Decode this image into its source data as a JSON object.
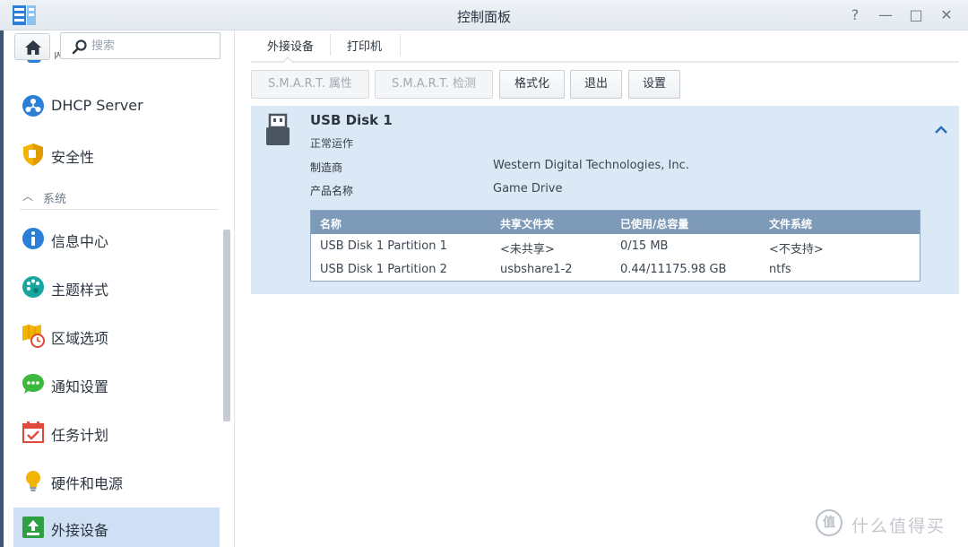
{
  "window": {
    "title": "控制面板",
    "buttons": {
      "help": "?",
      "minimize": "—",
      "maximize": "□",
      "close": "✕"
    }
  },
  "sidebar": {
    "search_placeholder": "搜索",
    "partial_item_label": "网络",
    "items": [
      {
        "label": "DHCP Server",
        "icon": "dhcp-server-icon"
      },
      {
        "label": "安全性",
        "icon": "shield-icon"
      }
    ],
    "section_label": "系统",
    "system_items": [
      {
        "label": "信息中心",
        "icon": "info-icon"
      },
      {
        "label": "主题样式",
        "icon": "palette-icon"
      },
      {
        "label": "区域选项",
        "icon": "map-clock-icon"
      },
      {
        "label": "通知设置",
        "icon": "chat-bubble-icon"
      },
      {
        "label": "任务计划",
        "icon": "calendar-check-icon"
      },
      {
        "label": "硬件和电源",
        "icon": "lightbulb-icon"
      },
      {
        "label": "外接设备",
        "icon": "external-device-icon",
        "active": true
      }
    ]
  },
  "tabs": [
    {
      "label": "外接设备",
      "active": true
    },
    {
      "label": "打印机",
      "active": false
    }
  ],
  "toolbar": {
    "smart_attributes": "S.M.A.R.T. 属性",
    "smart_test": "S.M.A.R.T. 检测",
    "format": "格式化",
    "eject": "退出",
    "settings": "设置"
  },
  "disk": {
    "name": "USB Disk 1",
    "status": "正常运作",
    "manufacturer_label": "制造商",
    "manufacturer": "Western Digital Technologies, Inc.",
    "product_label": "产品名称",
    "product": "Game Drive",
    "table": {
      "headers": [
        "名称",
        "共享文件夹",
        "已使用/总容量",
        "文件系统"
      ],
      "rows": [
        [
          "USB Disk 1 Partition 1",
          "<未共享>",
          "0/15 MB",
          "<不支持>"
        ],
        [
          "USB Disk 1 Partition 2",
          "usbshare1-2",
          "0.44/11175.98 GB",
          "ntfs"
        ]
      ]
    }
  },
  "watermark": {
    "glyph": "值",
    "text": "什么值得买"
  },
  "colors": {
    "accent": "#2b7fd6",
    "panel": "#dbe8f6",
    "table_header": "#7e9ab9",
    "active_item": "#cfe0f5"
  }
}
